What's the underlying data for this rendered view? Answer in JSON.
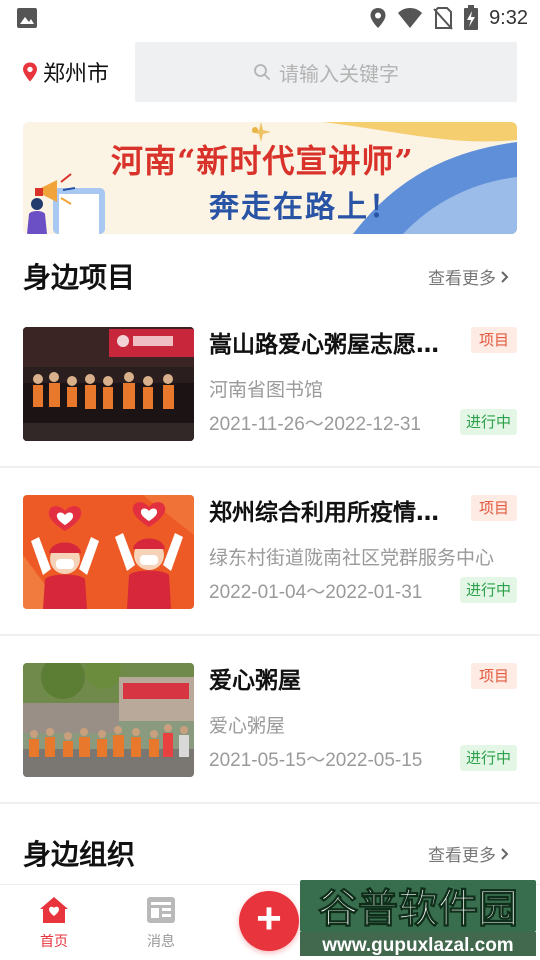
{
  "status_bar": {
    "time": "9:32",
    "icons": [
      "image-icon",
      "location-icon",
      "wifi-icon",
      "no-sim-icon",
      "battery-charging-icon"
    ]
  },
  "header": {
    "city": "郑州市",
    "search_placeholder": "请输入关键字"
  },
  "banner": {
    "line1": "河南“新时代宣讲师”",
    "line2": "奔走在路上！"
  },
  "projects_section": {
    "title": "身边项目",
    "more": "查看更多"
  },
  "projects": [
    {
      "title": "嵩山路爱心粥屋志愿服务",
      "tag": "项目",
      "org": "河南省图书馆",
      "date": "2021-11-26～2022-12-31",
      "status": "进行中"
    },
    {
      "title": "郑州综合利用所疫情防控",
      "tag": "项目",
      "org": "绿东村街道陇南社区党群服务中心",
      "date": "2022-01-04～2022-01-31",
      "status": "进行中"
    },
    {
      "title": "爱心粥屋",
      "tag": "项目",
      "org": "爱心粥屋",
      "date": "2021-05-15～2022-05-15",
      "status": "进行中"
    }
  ],
  "orgs_section": {
    "title": "身边组织",
    "more": "查看更多"
  },
  "bottom_nav": {
    "home": "首页",
    "messages": "消息"
  },
  "watermark": {
    "brand": "谷普软件园",
    "url": "www.gupuxlazal.com"
  },
  "colors": {
    "accent": "#e8343d",
    "tag_text": "#e3583d",
    "tag_bg": "#fdebe4",
    "status_text": "#2aa04a",
    "status_bg": "#e4f7e6",
    "search_bg": "#eff0f2"
  }
}
